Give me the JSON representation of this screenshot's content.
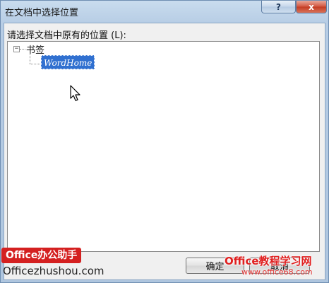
{
  "window": {
    "title": "在文档中选择位置",
    "help_label": "?",
    "close_label": "x"
  },
  "dialog": {
    "prompt": "请选择文档中原有的位置 (L):",
    "tree": {
      "expander_symbol": "−",
      "root_label": "书签",
      "child_label": "WordHome",
      "selected_color": "#3070d0"
    },
    "ok_label": "确定",
    "cancel_label": "取消"
  },
  "watermark": {
    "left_badge": "Office办公助手",
    "left_url": "Officezhushou.com",
    "right_title": "Office教程学习网",
    "right_url": "www.office68.com"
  },
  "colors": {
    "title_bar": "#b7cde5",
    "close_button": "#c33b22",
    "client_bg": "#f0f0f0"
  },
  "icons": [
    "question-icon",
    "close-icon",
    "mouse-pointer-icon",
    "tree-collapse-icon"
  ]
}
